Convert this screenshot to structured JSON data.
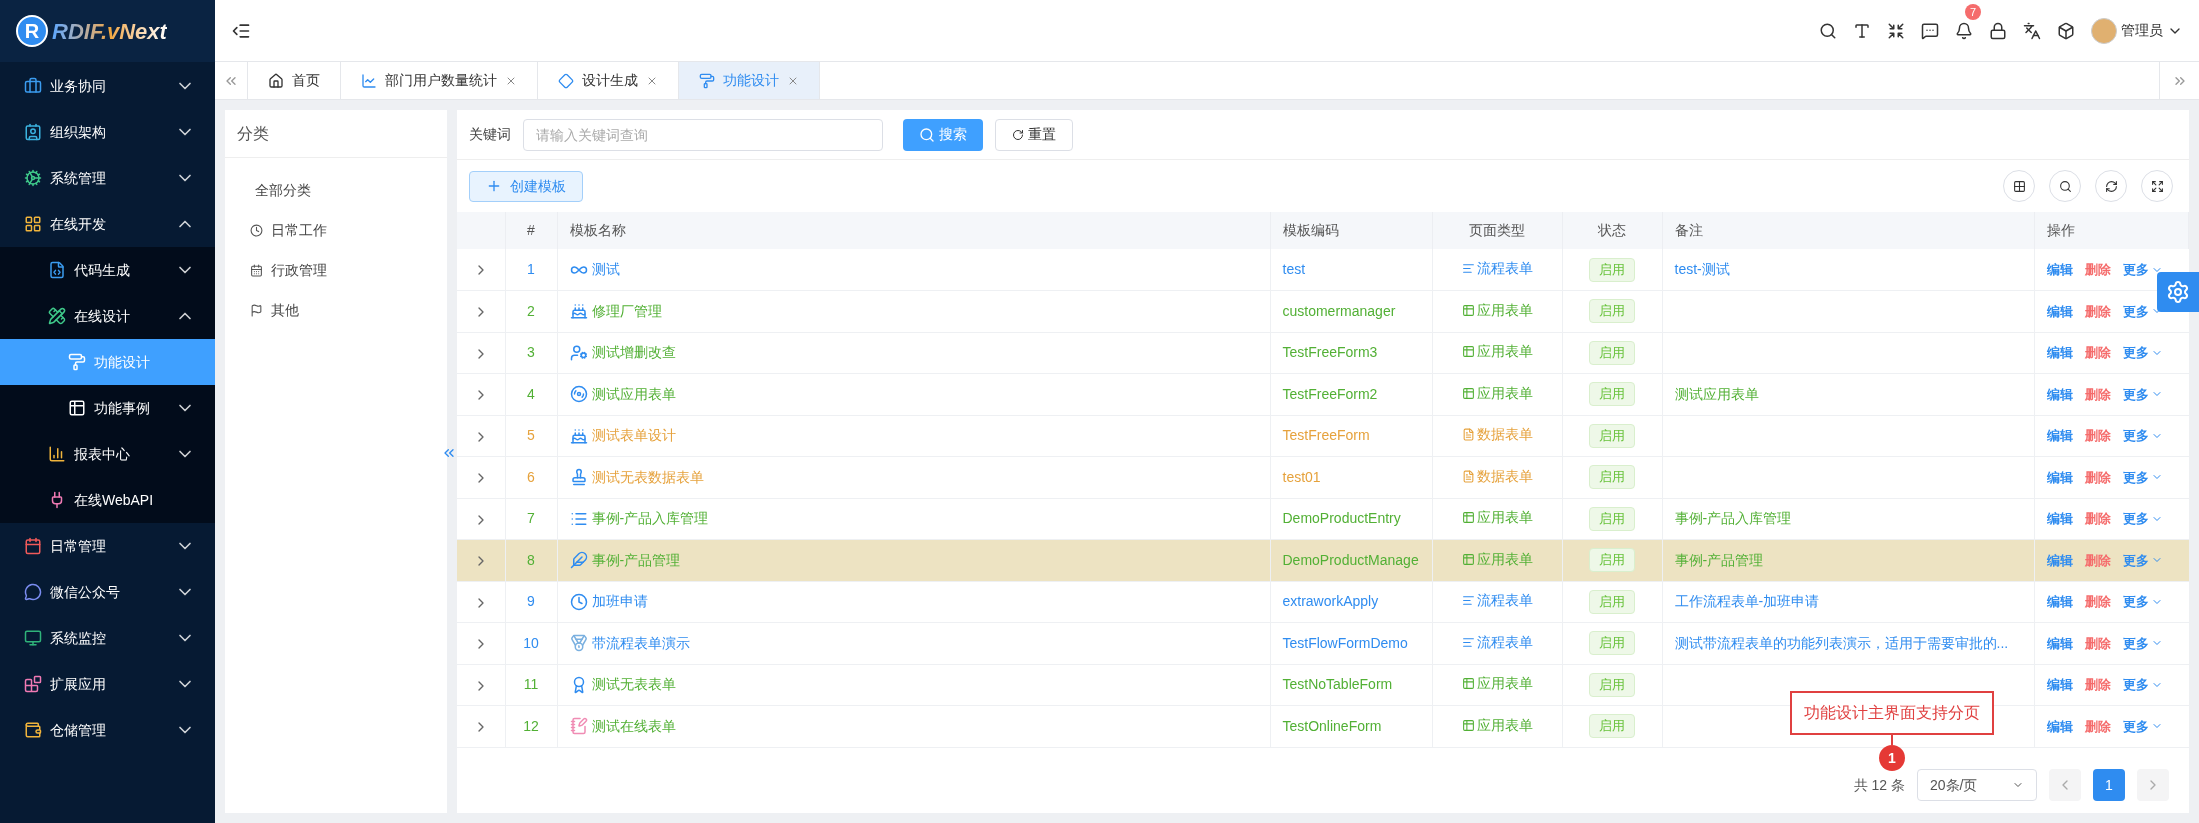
{
  "logo": {
    "mark": "R",
    "text": "RDIF.vNext"
  },
  "sidebar": {
    "items": [
      {
        "label": "业务协同",
        "expanded": false
      },
      {
        "label": "组织架构",
        "expanded": false
      },
      {
        "label": "系统管理",
        "expanded": false
      },
      {
        "label": "在线开发",
        "expanded": true,
        "children": [
          {
            "label": "代码生成",
            "expanded": false
          },
          {
            "label": "在线设计",
            "expanded": true,
            "children": [
              {
                "label": "功能设计",
                "selected": true
              },
              {
                "label": "功能事例",
                "selected": false,
                "expanded": false
              }
            ]
          },
          {
            "label": "报表中心",
            "expanded": false
          },
          {
            "label": "在线WebAPI"
          }
        ]
      },
      {
        "label": "日常管理",
        "expanded": false
      },
      {
        "label": "微信公众号",
        "expanded": false
      },
      {
        "label": "系统监控",
        "expanded": false
      },
      {
        "label": "扩展应用",
        "expanded": false
      },
      {
        "label": "仓储管理",
        "expanded": false
      }
    ]
  },
  "header": {
    "notification_count": "7",
    "user": "管理员"
  },
  "tabs": [
    {
      "label": "首页",
      "selected": false,
      "closable": false
    },
    {
      "label": "部门用户数量统计",
      "selected": false,
      "closable": true
    },
    {
      "label": "设计生成",
      "selected": false,
      "closable": true
    },
    {
      "label": "功能设计",
      "selected": true,
      "closable": true
    }
  ],
  "category_panel": {
    "title": "分类",
    "items": [
      {
        "label": "全部分类"
      },
      {
        "label": "日常工作"
      },
      {
        "label": "行政管理"
      },
      {
        "label": "其他"
      }
    ]
  },
  "search": {
    "label": "关键词",
    "placeholder": "请输入关键词查询",
    "search_button": "搜索",
    "reset_button": "重置"
  },
  "create_button": "创建模板",
  "table": {
    "columns": [
      "#",
      "模板名称",
      "模板编码",
      "页面类型",
      "状态",
      "备注",
      "操作"
    ],
    "rows": [
      {
        "index": "1",
        "name": "测试",
        "code": "test",
        "type": "流程表单",
        "kind": "flow",
        "status": "启用",
        "remark": "test-测试",
        "selected": false
      },
      {
        "index": "2",
        "name": "修理厂管理",
        "code": "customermanager",
        "type": "应用表单",
        "kind": "app",
        "status": "启用",
        "selected": false
      },
      {
        "index": "3",
        "name": "测试增删改查",
        "code": "TestFreeForm3",
        "type": "应用表单",
        "kind": "app",
        "status": "启用",
        "selected": false
      },
      {
        "index": "4",
        "name": "测试应用表单",
        "code": "TestFreeForm2",
        "type": "应用表单",
        "kind": "app",
        "status": "启用",
        "remark": "测试应用表单",
        "selected": false
      },
      {
        "index": "5",
        "name": "测试表单设计",
        "code": "TestFreeForm",
        "type": "数据表单",
        "kind": "data",
        "status": "启用",
        "selected": false
      },
      {
        "index": "6",
        "name": "测试无表数据表单",
        "code": "test01",
        "type": "数据表单",
        "kind": "data",
        "status": "启用",
        "selected": false
      },
      {
        "index": "7",
        "name": "事例-产品入库管理",
        "code": "DemoProductEntry",
        "type": "应用表单",
        "kind": "app",
        "status": "启用",
        "remark": "事例-产品入库管理",
        "selected": false
      },
      {
        "index": "8",
        "name": "事例-产品管理",
        "code": "DemoProductManage",
        "type": "应用表单",
        "kind": "app",
        "status": "启用",
        "remark": "事例-产品管理",
        "selected": true
      },
      {
        "index": "9",
        "name": "加班申请",
        "code": "extraworkApply",
        "type": "流程表单",
        "kind": "flow",
        "status": "启用",
        "remark": "工作流程表单-加班申请",
        "selected": false
      },
      {
        "index": "10",
        "name": "带流程表单演示",
        "code": "TestFlowFormDemo",
        "type": "流程表单",
        "kind": "flow",
        "status": "启用",
        "remark": "测试带流程表单的功能列表演示，适用于需要审批的...",
        "selected": false
      },
      {
        "index": "11",
        "name": "测试无表表单",
        "code": "TestNoTableForm",
        "type": "应用表单",
        "kind": "app",
        "status": "启用",
        "selected": false
      },
      {
        "index": "12",
        "name": "测试在线表单",
        "code": "TestOnlineForm",
        "type": "应用表单",
        "kind": "app",
        "status": "启用",
        "selected": false
      }
    ],
    "actions": [
      {
        "edit": "编辑",
        "delete": "删除",
        "more": "更多"
      },
      {
        "edit": "编辑",
        "delete": "删除",
        "more": "更多"
      },
      {
        "edit": "编辑",
        "delete": "删除",
        "more": "更多"
      },
      {
        "edit": "编辑",
        "delete": "删除",
        "more": "更多"
      },
      {
        "edit": "编辑",
        "delete": "删除",
        "more": "更多"
      },
      {
        "edit": "编辑",
        "delete": "删除",
        "more": "更多"
      },
      {
        "edit": "编辑",
        "delete": "删除",
        "more": "更多"
      },
      {
        "edit": "编辑",
        "delete": "删除",
        "more": "更多"
      },
      {
        "edit": "编辑",
        "delete": "删除",
        "more": "更多"
      },
      {
        "edit": "编辑",
        "delete": "删除",
        "more": "更多"
      },
      {
        "edit": "编辑",
        "delete": "删除",
        "more": "更多"
      },
      {
        "edit": "编辑",
        "delete": "删除",
        "more": "更多"
      }
    ]
  },
  "pagination": {
    "total": "共 12 条",
    "page_size": "20条/页",
    "pages": [
      {
        "label": "1",
        "selected": true
      }
    ]
  },
  "callout": {
    "text": "功能设计主界面支持分页",
    "marker": "1"
  }
}
